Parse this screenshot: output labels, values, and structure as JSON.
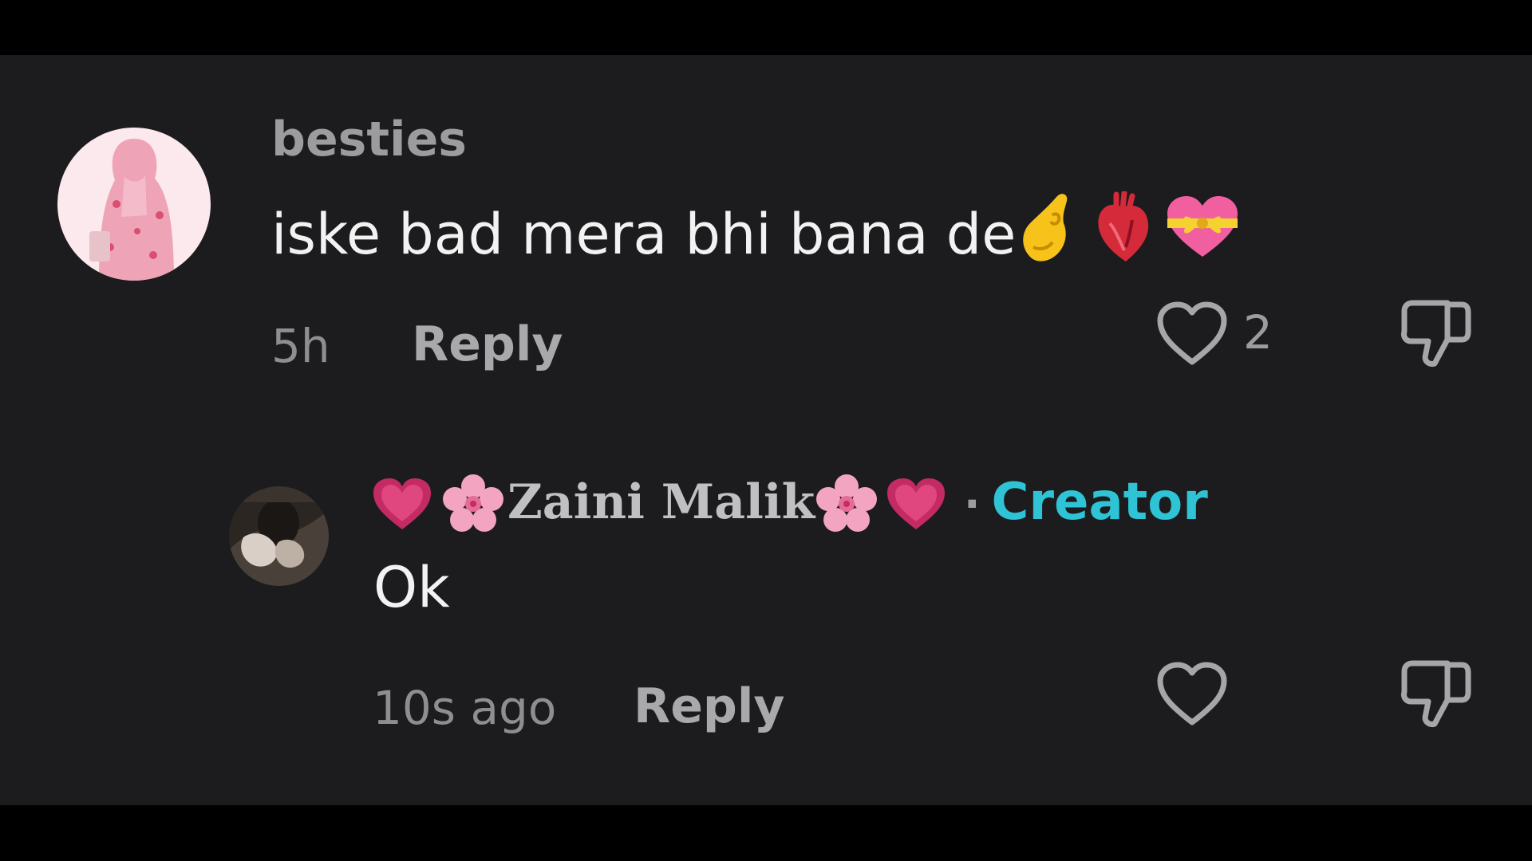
{
  "comments": [
    {
      "username": "besties",
      "text": "iske bad mera bhi bana de",
      "emojis": [
        "pinched-fingers",
        "anatomical-heart",
        "heart-with-ribbon"
      ],
      "time": "5h",
      "reply_label": "Reply",
      "like_count": "2"
    },
    {
      "username": "Zaini Malik",
      "username_emojis_left": [
        "growing-heart",
        "cherry-blossom"
      ],
      "username_emojis_right": [
        "cherry-blossom",
        "growing-heart"
      ],
      "separator": "·",
      "badge": "Creator",
      "text": "Ok",
      "time": "10s ago",
      "reply_label": "Reply",
      "like_count": ""
    }
  ],
  "colors": {
    "background": "#1c1c1e",
    "letterbox": "#000000",
    "creator_badge": "#2ec4d6",
    "muted_text": "#9c9c9e",
    "primary_text": "#f2f2f2"
  },
  "icons": [
    "heart-outline-icon",
    "thumbs-down-icon"
  ]
}
